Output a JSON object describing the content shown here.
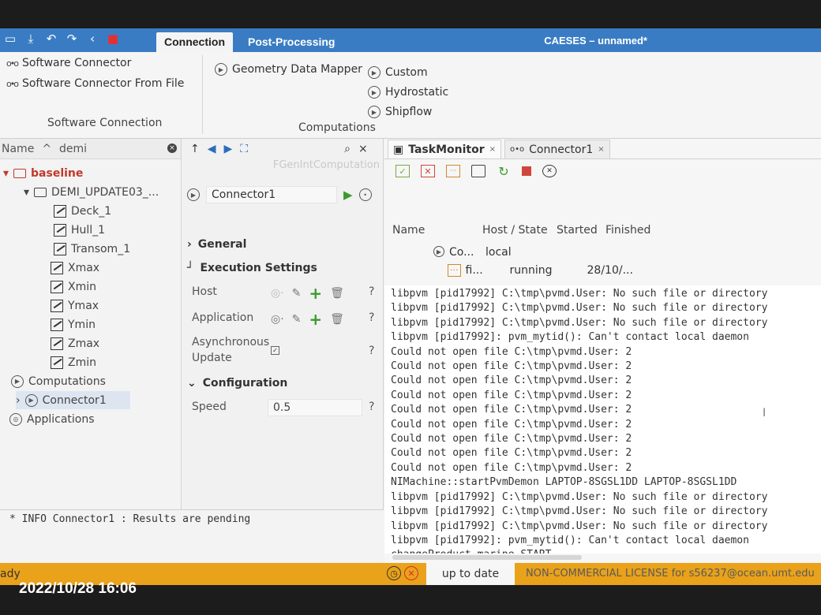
{
  "window": {
    "title": "CAESES – unnamed*",
    "tabs": [
      "Connection",
      "Post-Processing"
    ]
  },
  "ribbon": {
    "software_connector": "Software Connector",
    "software_connector_from_file": "Software Connector From File",
    "software_connection_group": "Software Connection",
    "geometry_data_mapper": "Geometry Data Mapper",
    "custom": "Custom",
    "hydrostatic": "Hydrostatic",
    "shipflow": "Shipflow",
    "computations_group": "Computations"
  },
  "tree": {
    "name_label": "Name",
    "filter_value": "demi",
    "items": [
      {
        "label": "baseline"
      },
      {
        "label": "DEMI_UPDATE03_..."
      },
      {
        "label": "Deck_1"
      },
      {
        "label": "Hull_1"
      },
      {
        "label": "Transom_1"
      },
      {
        "label": "Xmax"
      },
      {
        "label": "Xmin"
      },
      {
        "label": "Ymax"
      },
      {
        "label": "Ymin"
      },
      {
        "label": "Zmax"
      },
      {
        "label": "Zmin"
      },
      {
        "label": "Computations"
      },
      {
        "label": "Connector1"
      },
      {
        "label": "Applications"
      }
    ]
  },
  "props": {
    "title": "FGenIntComputation",
    "connector_name": "Connector1",
    "general": "General",
    "execution_settings": "Execution Settings",
    "host": "Host",
    "application": "Application",
    "async_line1": "Asynchronous",
    "async_line2": "Update",
    "configuration": "Configuration",
    "speed_label": "Speed",
    "speed_value": "0.5",
    "help": "?"
  },
  "info": {
    "message": "* INFO Connector1 : Results are pending"
  },
  "monitor": {
    "tab_taskmonitor": "TaskMonitor",
    "tab_connector": "Connector1",
    "columns": [
      "Name",
      "Host / State",
      "Started",
      "Finished"
    ],
    "rows": [
      {
        "name": "Co...",
        "state": "local",
        "started": ""
      },
      {
        "name": "fi...",
        "state": "running",
        "started": "28/10/..."
      }
    ],
    "log_lines": [
      "libpvm [pid17992] C:\\tmp\\pvmd.User: No such file or directory",
      "libpvm [pid17992] C:\\tmp\\pvmd.User: No such file or directory",
      "libpvm [pid17992] C:\\tmp\\pvmd.User: No such file or directory",
      "libpvm [pid17992]: pvm_mytid(): Can't contact local daemon",
      "Could not open file C:\\tmp\\pvmd.User: 2",
      "Could not open file C:\\tmp\\pvmd.User: 2",
      "Could not open file C:\\tmp\\pvmd.User: 2",
      "Could not open file C:\\tmp\\pvmd.User: 2",
      "Could not open file C:\\tmp\\pvmd.User: 2",
      "Could not open file C:\\tmp\\pvmd.User: 2",
      "Could not open file C:\\tmp\\pvmd.User: 2",
      "Could not open file C:\\tmp\\pvmd.User: 2",
      "Could not open file C:\\tmp\\pvmd.User: 2",
      "NIMachine::startPvmDemon LAPTOP-8SGSL1DD LAPTOP-8SGSL1DD",
      "libpvm [pid17992] C:\\tmp\\pvmd.User: No such file or directory",
      "libpvm [pid17992] C:\\tmp\\pvmd.User: No such file or directory",
      "libpvm [pid17992] C:\\tmp\\pvmd.User: No such file or directory",
      "libpvm [pid17992]: pvm_mytid(): Can't contact local daemon",
      "changeProduct marine START"
    ]
  },
  "status": {
    "left": "ady",
    "up_to_date": "up to date",
    "license": "NON-COMMERCIAL LICENSE for s56237@ocean.umt.edu"
  },
  "photo_timestamp": "2022/10/28 16:06",
  "colors": {
    "ribbon_blue": "#3a7cc4",
    "status_orange": "#e9a21a",
    "accent_red": "#c0392b",
    "run_green": "#3d9a2e"
  }
}
